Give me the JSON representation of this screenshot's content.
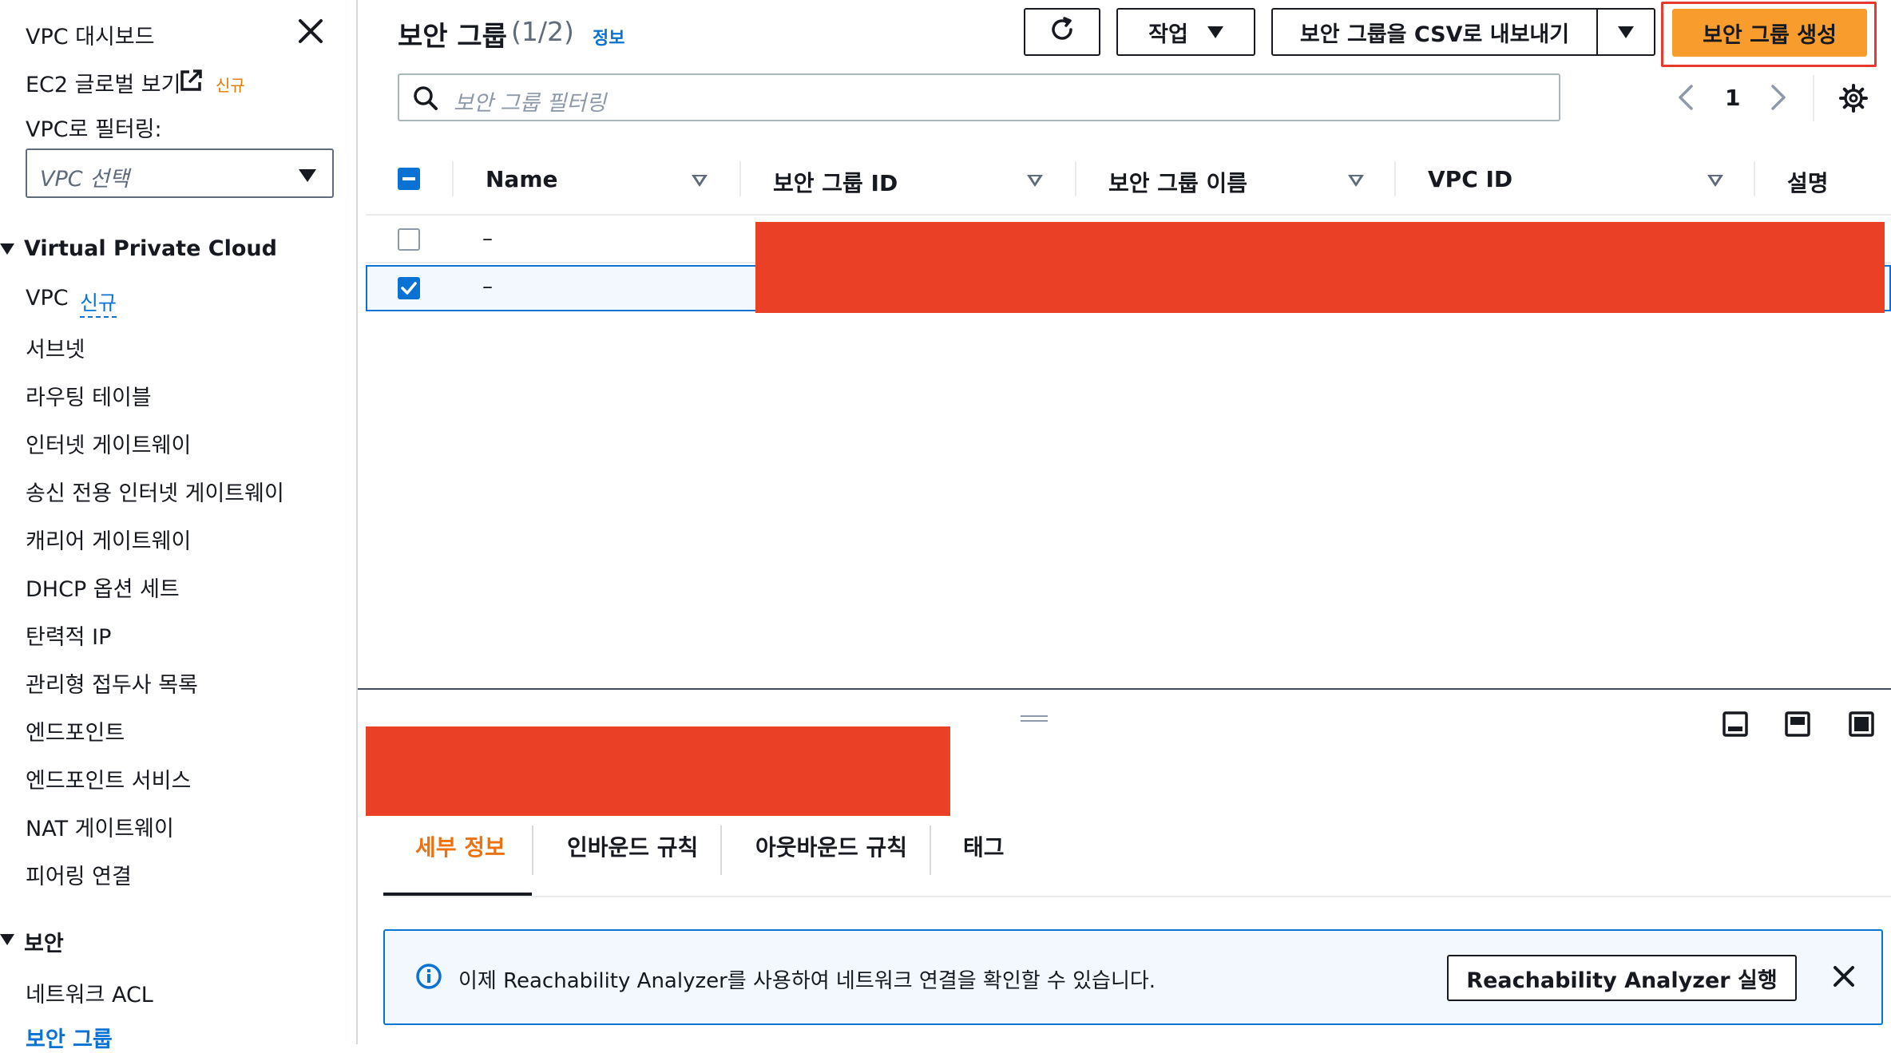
{
  "sidebar": {
    "dashboard": "VPC 대시보드",
    "ec2_global": "EC2 글로벌 보기",
    "ec2_global_badge": "신규",
    "filter_label": "VPC로 필터링:",
    "filter_placeholder": "VPC 선택",
    "section_vpc": "Virtual Private Cloud",
    "vpc_item": "VPC",
    "vpc_badge": "신규",
    "items": [
      "서브넷",
      "라우팅 테이블",
      "인터넷 게이트웨이",
      "송신 전용 인터넷 게이트웨이",
      "캐리어 게이트웨이",
      "DHCP 옵션 세트",
      "탄력적 IP",
      "관리형 접두사 목록",
      "엔드포인트",
      "엔드포인트 서비스",
      "NAT 게이트웨이",
      "피어링 연결"
    ],
    "section_security": "보안",
    "security_items": [
      "네트워크 ACL",
      "보안 그룹"
    ]
  },
  "header": {
    "title": "보안 그룹",
    "count": "(1/2)",
    "info_link": "정보",
    "actions_label": "작업",
    "export_label": "보안 그룹을 CSV로 내보내기",
    "create_label": "보안 그룹 생성"
  },
  "search": {
    "placeholder": "보안 그룹 필터링"
  },
  "pagination": {
    "page": "1"
  },
  "table": {
    "columns": [
      "Name",
      "보안 그룹 ID",
      "보안 그룹 이름",
      "VPC ID",
      "설명"
    ],
    "rows": [
      {
        "name": "–",
        "selected": false
      },
      {
        "name": "–",
        "selected": true
      }
    ]
  },
  "details": {
    "tabs": [
      "세부 정보",
      "인바운드 규칙",
      "아웃바운드 규칙",
      "태그"
    ],
    "active_tab": "세부 정보",
    "banner_text": "이제 Reachability Analyzer를 사용하여 네트워크 연결을 확인할 수 있습니다.",
    "banner_button": "Reachability Analyzer 실행"
  },
  "colors": {
    "accent_orange": "#f89c2e",
    "highlight_red": "#e8392f",
    "redact": "#ea4026",
    "link_blue": "#0972d3",
    "selected_row": "#f2f8fd",
    "info_banner_border": "#0972d3"
  }
}
